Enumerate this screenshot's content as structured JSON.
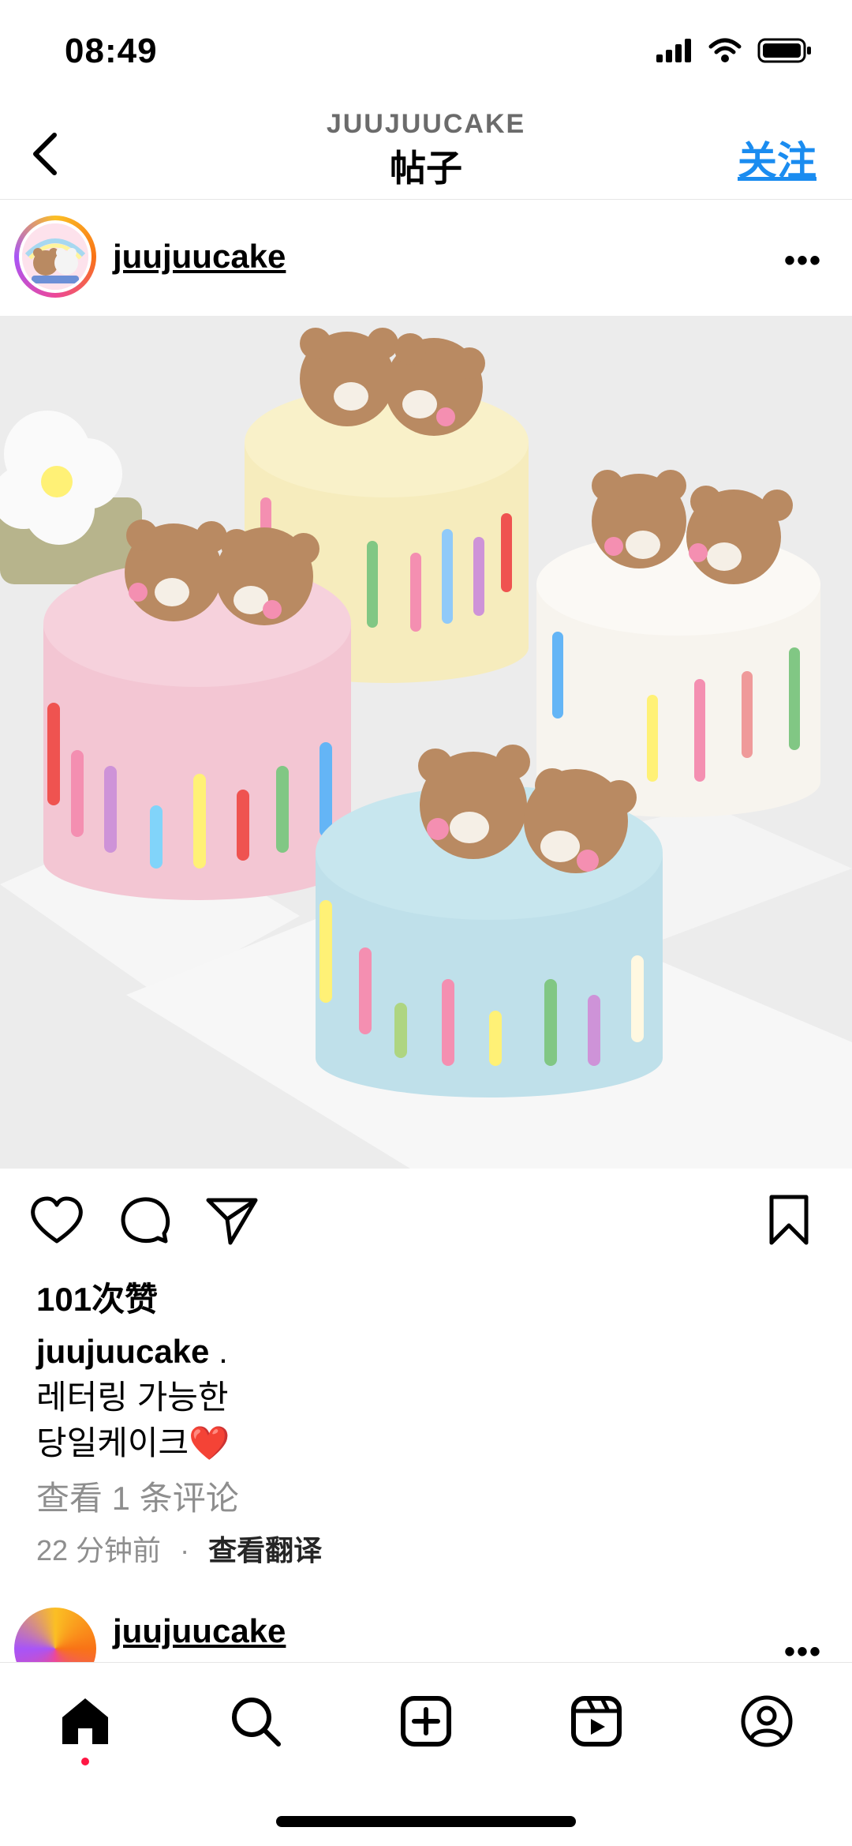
{
  "status_bar": {
    "time": "08:49"
  },
  "header": {
    "account": "JUUJUUCAKE",
    "title": "帖子",
    "follow_label": "关注"
  },
  "post": {
    "username": "juujuucake",
    "likes": "101次赞",
    "caption_user": "juujuucake",
    "caption_rest": " .",
    "caption_lines": [
      "레터링 가능한",
      "당일케이크❤️"
    ],
    "comments_link": "查看 1 条评论",
    "time_ago": "22 分钟前",
    "separator": "·",
    "translate_label": "查看翻译"
  },
  "next_post": {
    "username": "juujuucake"
  },
  "colors": {
    "accent": "#1a8cf0",
    "notify_dot": "#ff1744"
  },
  "icons": [
    "back-icon",
    "more-icon",
    "heart-icon",
    "comment-icon",
    "share-icon",
    "bookmark-icon",
    "home-icon",
    "search-icon",
    "create-icon",
    "reels-icon",
    "profile-icon"
  ]
}
